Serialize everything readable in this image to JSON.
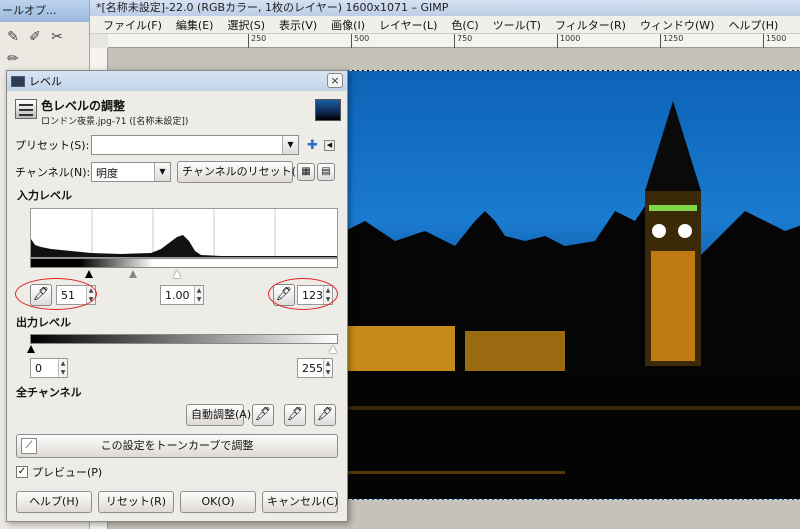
{
  "toolbox": {
    "title": "ールオプ..."
  },
  "image_window": {
    "title": "*[名称未設定]-22.0 (RGBカラー, 1枚のレイヤー) 1600x1071 – GIMP",
    "menu": [
      "ファイル(F)",
      "編集(E)",
      "選択(S)",
      "表示(V)",
      "画像(I)",
      "レイヤー(L)",
      "色(C)",
      "ツール(T)",
      "フィルター(R)",
      "ウィンドウ(W)",
      "ヘルプ(H)"
    ],
    "ruler_ticks": [
      "250",
      "500",
      "750",
      "1000",
      "1250",
      "1500"
    ]
  },
  "dialog": {
    "title": "レベル",
    "heading": "色レベルの調整",
    "subheading": "ロンドン夜景.jpg-71 ([名称未設定])",
    "preset_label": "プリセット(S):",
    "preset_value": "",
    "channel_label": "チャンネル(N):",
    "channel_value": "明度",
    "reset_channel_label": "チャンネルのリセット(E)",
    "input_levels_label": "入力レベル",
    "input_low": "51",
    "input_gamma": "1.00",
    "input_high": "123",
    "output_levels_label": "出力レベル",
    "output_low": "0",
    "output_high": "255",
    "all_channels_label": "全チャンネル",
    "auto_button": "自動調整(A)",
    "curves_button": "この設定をトーンカーブで調整",
    "preview_label": "プレビュー(P)",
    "preview_checked": true,
    "help_button": "ヘルプ(H)",
    "reset_button": "リセット(R)",
    "ok_button": "OK(O)",
    "cancel_button": "キャンセル(C)",
    "close_icon": "×"
  }
}
